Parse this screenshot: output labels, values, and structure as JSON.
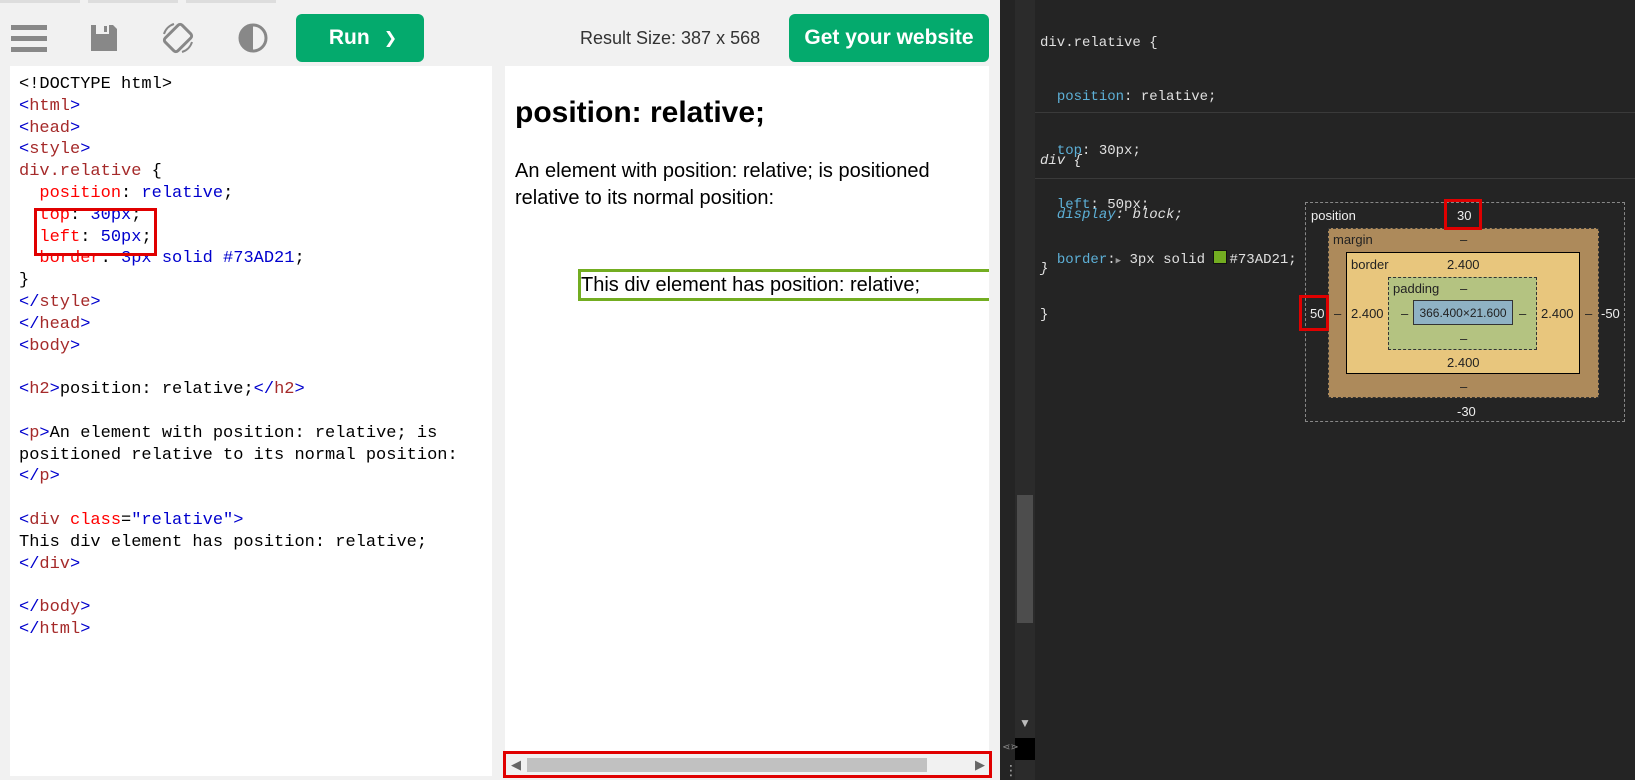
{
  "toolbar": {
    "run_label": "Run",
    "run_chevron": "❯",
    "result_size": "Result Size: 387 x 568",
    "get_website_label": "Get your website"
  },
  "editor": {
    "lines": [
      [
        {
          "t": "<!DOCTYPE html>",
          "c": "tx"
        }
      ],
      [
        {
          "t": "<",
          "c": "tb"
        },
        {
          "t": "html",
          "c": "tg"
        },
        {
          "t": ">",
          "c": "tb"
        }
      ],
      [
        {
          "t": "<",
          "c": "tb"
        },
        {
          "t": "head",
          "c": "tg"
        },
        {
          "t": ">",
          "c": "tb"
        }
      ],
      [
        {
          "t": "<",
          "c": "tb"
        },
        {
          "t": "style",
          "c": "tg"
        },
        {
          "t": ">",
          "c": "tb"
        }
      ],
      [
        {
          "t": "div.relative ",
          "c": "tg"
        },
        {
          "t": "{",
          "c": "br"
        }
      ],
      [
        {
          "t": "  position",
          "c": "at"
        },
        {
          "t": ": ",
          "c": "br"
        },
        {
          "t": "relative",
          "c": "av"
        },
        {
          "t": ";",
          "c": "br"
        }
      ],
      [
        {
          "t": "  top",
          "c": "at"
        },
        {
          "t": ": ",
          "c": "br"
        },
        {
          "t": "30px",
          "c": "av"
        },
        {
          "t": ";",
          "c": "br"
        }
      ],
      [
        {
          "t": "  left",
          "c": "at"
        },
        {
          "t": ": ",
          "c": "br"
        },
        {
          "t": "50px",
          "c": "av"
        },
        {
          "t": ";",
          "c": "br"
        }
      ],
      [
        {
          "t": "  border",
          "c": "at"
        },
        {
          "t": ": ",
          "c": "br"
        },
        {
          "t": "3px solid #73AD21",
          "c": "av"
        },
        {
          "t": ";",
          "c": "br"
        }
      ],
      [
        {
          "t": "}",
          "c": "br"
        }
      ],
      [
        {
          "t": "</",
          "c": "tb"
        },
        {
          "t": "style",
          "c": "tg"
        },
        {
          "t": ">",
          "c": "tb"
        }
      ],
      [
        {
          "t": "</",
          "c": "tb"
        },
        {
          "t": "head",
          "c": "tg"
        },
        {
          "t": ">",
          "c": "tb"
        }
      ],
      [
        {
          "t": "<",
          "c": "tb"
        },
        {
          "t": "body",
          "c": "tg"
        },
        {
          "t": ">",
          "c": "tb"
        }
      ],
      [],
      [
        {
          "t": "<",
          "c": "tb"
        },
        {
          "t": "h2",
          "c": "tg"
        },
        {
          "t": ">",
          "c": "tb"
        },
        {
          "t": "position: relative;",
          "c": "tx"
        },
        {
          "t": "</",
          "c": "tb"
        },
        {
          "t": "h2",
          "c": "tg"
        },
        {
          "t": ">",
          "c": "tb"
        }
      ],
      [],
      [
        {
          "t": "<",
          "c": "tb"
        },
        {
          "t": "p",
          "c": "tg"
        },
        {
          "t": ">",
          "c": "tb"
        },
        {
          "t": "An element with position: relative; is",
          "c": "tx"
        }
      ],
      [
        {
          "t": "positioned relative to its normal position:",
          "c": "tx"
        }
      ],
      [
        {
          "t": "</",
          "c": "tb"
        },
        {
          "t": "p",
          "c": "tg"
        },
        {
          "t": ">",
          "c": "tb"
        }
      ],
      [],
      [
        {
          "t": "<",
          "c": "tb"
        },
        {
          "t": "div ",
          "c": "tg"
        },
        {
          "t": "class",
          "c": "at"
        },
        {
          "t": "=",
          "c": "br"
        },
        {
          "t": "\"relative\"",
          "c": "av"
        },
        {
          "t": ">",
          "c": "tb"
        }
      ],
      [
        {
          "t": "This div element has position: relative;",
          "c": "tx"
        }
      ],
      [
        {
          "t": "</",
          "c": "tb"
        },
        {
          "t": "div",
          "c": "tg"
        },
        {
          "t": ">",
          "c": "tb"
        }
      ],
      [],
      [
        {
          "t": "</",
          "c": "tb"
        },
        {
          "t": "body",
          "c": "tg"
        },
        {
          "t": ">",
          "c": "tb"
        }
      ],
      [
        {
          "t": "</",
          "c": "tb"
        },
        {
          "t": "html",
          "c": "tg"
        },
        {
          "t": ">",
          "c": "tb"
        }
      ]
    ]
  },
  "result": {
    "heading": "position: relative;",
    "paragraph": "An element with position: relative; is positioned relative to its normal position:",
    "div_text": "This div element has position: relative;"
  },
  "devtools": {
    "rule1": {
      "selector": "div.relative {",
      "props": [
        {
          "name": "position",
          "value": "relative;"
        },
        {
          "name": "top",
          "value": "30px;"
        },
        {
          "name": "left",
          "value": "50px;"
        },
        {
          "name": "border",
          "value": "3px solid ",
          "color_text": "#73AD21;",
          "arrow": "▶"
        }
      ],
      "close": "}"
    },
    "rule2": {
      "selector": "div {",
      "props": [
        {
          "name": "display",
          "value": "block;"
        }
      ],
      "close": "}"
    },
    "box_model": {
      "position_label": "position",
      "position_top": "30",
      "position_left": "50",
      "position_right": "-50",
      "position_bottom": "-30",
      "margin_label": "margin",
      "margin_top": "–",
      "margin_bottom": "–",
      "margin_left": "–",
      "margin_right": "–",
      "border_label": "border",
      "border_top": "2.400",
      "border_bottom": "2.400",
      "border_left": "2.400",
      "border_right": "2.400",
      "padding_label": "padding",
      "padding_top": "–",
      "padding_bottom": "–",
      "padding_left": "–",
      "padding_right": "–",
      "content_size": "366.400×21.600"
    },
    "dots": "⋮"
  },
  "colors": {
    "green_button": "#04aa6d",
    "highlight": "#e00000",
    "div_border": "#73AD21"
  }
}
